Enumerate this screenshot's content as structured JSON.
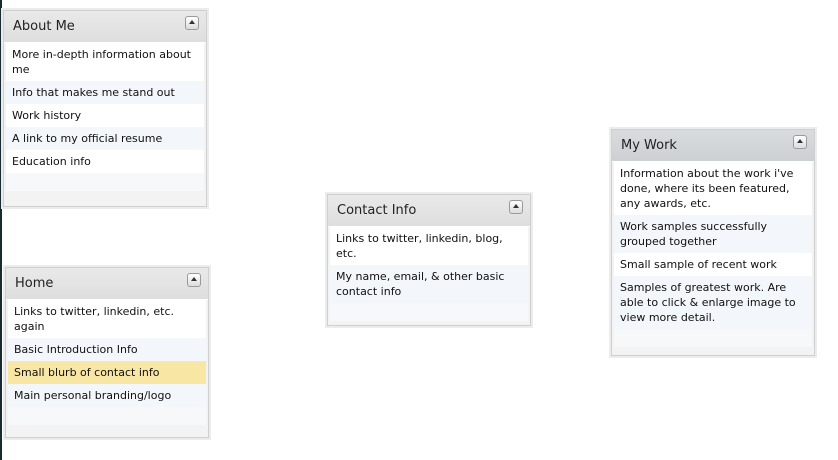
{
  "panels": {
    "about_me": {
      "title": "About Me",
      "items": [
        "More in-depth information about me",
        "Info that makes me stand out",
        "Work history",
        "A link to my official resume",
        "Education info"
      ]
    },
    "home": {
      "title": "Home",
      "items": [
        "Links to twitter, linkedin, etc. again",
        "Basic Introduction Info",
        "Small blurb of contact info",
        "Main personal branding/logo"
      ],
      "selected_index": 2
    },
    "contact_info": {
      "title": "Contact Info",
      "items": [
        "Links to twitter, linkedin, blog, etc.",
        "My name, email, & other basic contact info"
      ]
    },
    "my_work": {
      "title": "My Work",
      "items": [
        "Information about the work i've done, where its been featured, any awards, etc.",
        "Work samples successfully grouped together",
        "Small sample of recent work",
        "Samples of greatest work. Are able to click & enlarge image to view more detail."
      ]
    }
  },
  "colors": {
    "selected_row": "#f8e6a4",
    "alt_row": "#f3f6fa",
    "header": "#e4e4e4"
  },
  "icons": {
    "collapse": "triangle-up-icon"
  }
}
